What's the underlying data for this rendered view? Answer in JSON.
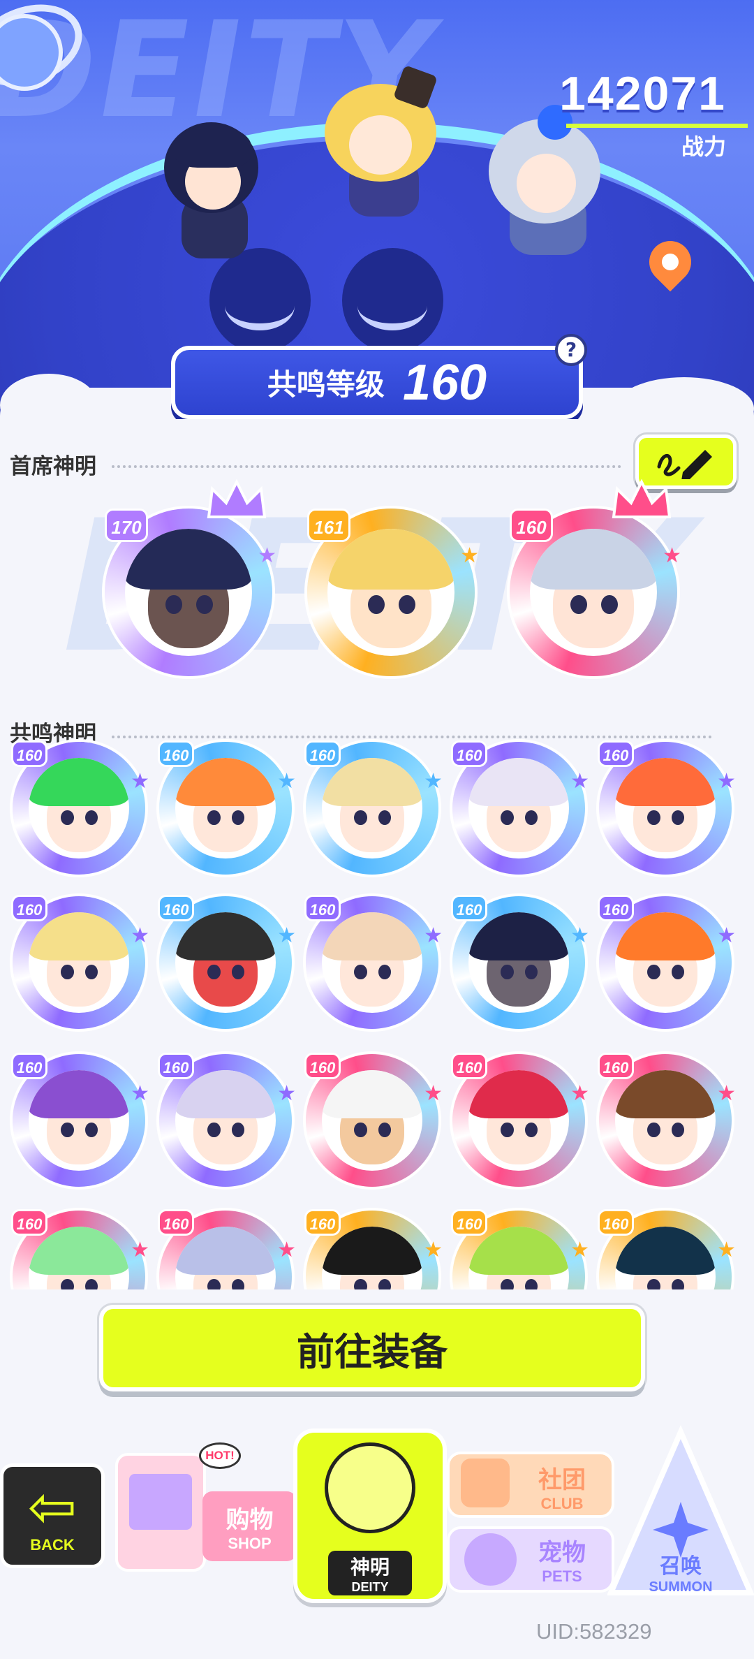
{
  "hero": {
    "bg_word": "DEITY",
    "power_value": "142071",
    "power_label": "战力",
    "resonance_label": "共鸣等级",
    "resonance_level": "160",
    "help": "?"
  },
  "chief": {
    "title": "首席神明",
    "avatars": [
      {
        "level": "170",
        "ring": "#b07cff",
        "hair": "#242a57",
        "skin": "#6b5450",
        "crown": true
      },
      {
        "level": "161",
        "ring": "#ffb020",
        "hair": "#f5d36a",
        "skin": "#ffe3c8",
        "crown": false
      },
      {
        "level": "160",
        "ring": "#ff4e8a",
        "hair": "#c9d3e6",
        "skin": "#ffe4d6",
        "crown": true
      }
    ]
  },
  "resonance": {
    "title": "共鸣神明",
    "avatars": [
      {
        "level": "160",
        "ring": "#8f6bff",
        "hair": "#35d75a",
        "skin": "#ffe7da"
      },
      {
        "level": "160",
        "ring": "#52b6ff",
        "hair": "#ff8a3a",
        "skin": "#ffe7da"
      },
      {
        "level": "160",
        "ring": "#52b6ff",
        "hair": "#f2dfa3",
        "skin": "#ffe7da"
      },
      {
        "level": "160",
        "ring": "#8f6bff",
        "hair": "#e9e4f5",
        "skin": "#ffe7da"
      },
      {
        "level": "160",
        "ring": "#8f6bff",
        "hair": "#ff6b3a",
        "skin": "#ffe7da"
      },
      {
        "level": "160",
        "ring": "#8f6bff",
        "hair": "#f5df8a",
        "skin": "#ffe7da"
      },
      {
        "level": "160",
        "ring": "#52b6ff",
        "hair": "#2f2f2f",
        "skin": "#e84a4a"
      },
      {
        "level": "160",
        "ring": "#8f6bff",
        "hair": "#f3d6b8",
        "skin": "#ffe7da"
      },
      {
        "level": "160",
        "ring": "#52b6ff",
        "hair": "#1d2145",
        "skin": "#6d6470"
      },
      {
        "level": "160",
        "ring": "#8f6bff",
        "hair": "#ff7a2a",
        "skin": "#ffe7da"
      },
      {
        "level": "160",
        "ring": "#8f6bff",
        "hair": "#8a4fd0",
        "skin": "#ffe7da"
      },
      {
        "level": "160",
        "ring": "#8f6bff",
        "hair": "#d8d2f0",
        "skin": "#ffe7da"
      },
      {
        "level": "160",
        "ring": "#ff4e8a",
        "hair": "#f5f5f5",
        "skin": "#f3c99e"
      },
      {
        "level": "160",
        "ring": "#ff4e8a",
        "hair": "#e02b4b",
        "skin": "#ffe7da"
      },
      {
        "level": "160",
        "ring": "#ff4e8a",
        "hair": "#7a4a2a",
        "skin": "#ffe7da"
      },
      {
        "level": "160",
        "ring": "#ff4e8a",
        "hair": "#8be89a",
        "skin": "#ffe7da"
      },
      {
        "level": "160",
        "ring": "#ff4e8a",
        "hair": "#b9c0e8",
        "skin": "#ffe7da"
      },
      {
        "level": "160",
        "ring": "#ffb020",
        "hair": "#1a1a1a",
        "skin": "#ffe7da"
      },
      {
        "level": "160",
        "ring": "#ffb020",
        "hair": "#a6e04a",
        "skin": "#ffe7da"
      },
      {
        "level": "160",
        "ring": "#ffb020",
        "hair": "#12324a",
        "skin": "#ffe7da"
      }
    ]
  },
  "go_button": "前往装备",
  "nav": {
    "back": "BACK",
    "shop_cn": "购物",
    "shop_en": "SHOP",
    "shop_badge": "HOT!",
    "deity_cn": "神明",
    "deity_en": "DEITY",
    "club_cn": "社团",
    "club_en": "CLUB",
    "pets_cn": "宠物",
    "pets_en": "PETS",
    "summon_cn": "召唤",
    "summon_en": "SUMMON"
  },
  "uid": "UID:582329",
  "colors": {
    "accent_lime": "#e5ff1e",
    "hero_blue": "#4d6df2",
    "banner_blue": "#2e43d0"
  }
}
